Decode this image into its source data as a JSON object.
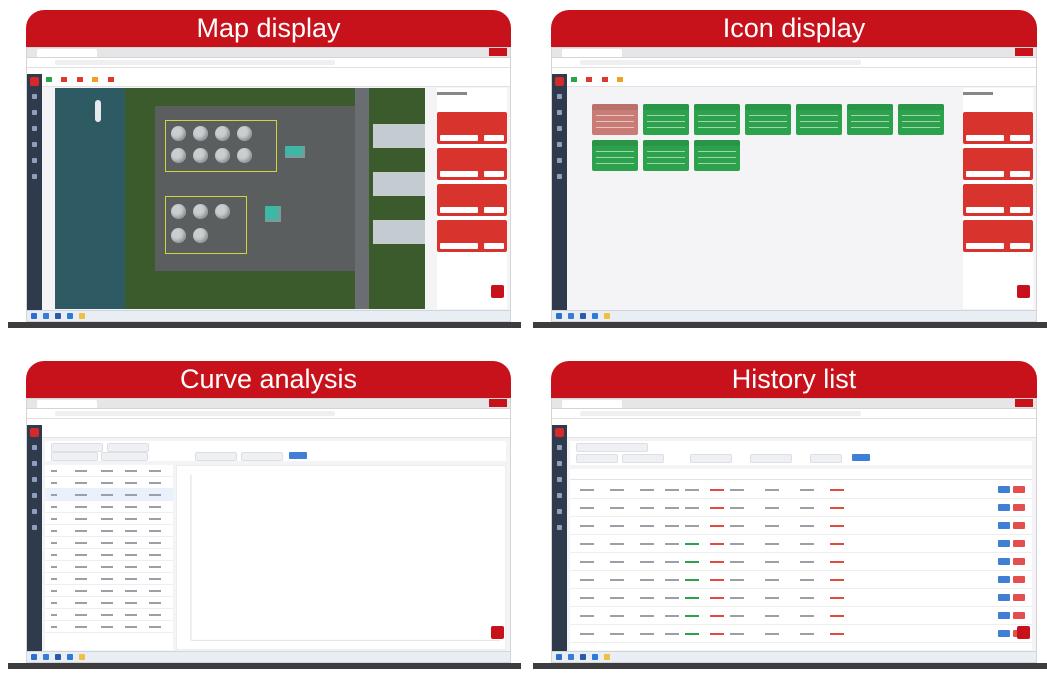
{
  "panels": {
    "map": {
      "title": "Map display"
    },
    "icon": {
      "title": "Icon display"
    },
    "curve": {
      "title": "Curve analysis"
    },
    "history": {
      "title": "History list"
    }
  },
  "colors": {
    "banner": "#c8121b",
    "alarm_card": "#d8332c",
    "status_green": "#2da24d",
    "status_red": "#c97b76",
    "sidebar": "#2f3a4d",
    "button_blue": "#3f7fd6",
    "button_red": "#e34e4e"
  },
  "icons": {
    "logo": "app-logo-icon",
    "sidebar": [
      "home-icon",
      "device-icon",
      "alarm-icon",
      "chart-icon",
      "list-icon",
      "settings-icon"
    ],
    "taskbar": [
      "start-icon",
      "search-icon",
      "taskview-icon",
      "browser-icon",
      "explorer-icon"
    ]
  },
  "icon_display": {
    "cards_row1": [
      "red",
      "green",
      "green",
      "green",
      "green",
      "green",
      "green"
    ],
    "cards_row2": [
      "green",
      "green",
      "green"
    ]
  },
  "alarm_panel": {
    "card_count": 4
  },
  "history_list": {
    "row_count": 9
  }
}
